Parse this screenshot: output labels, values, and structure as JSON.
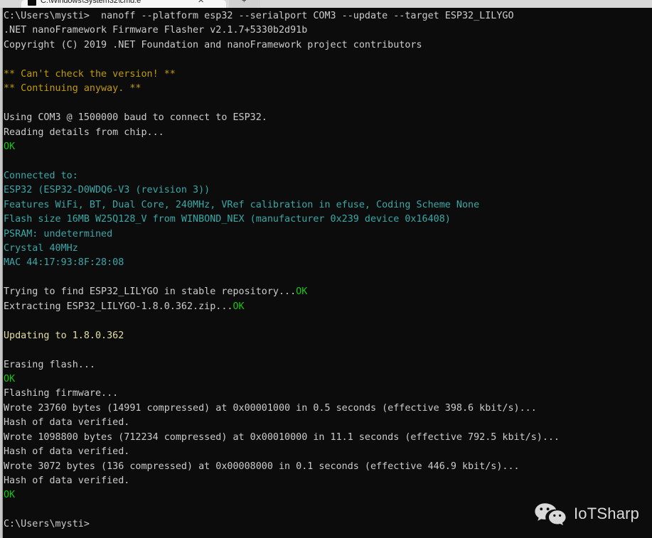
{
  "window": {
    "tab_title": "C:\\Windows\\System32\\cmd.e",
    "tab_close_label": "✕",
    "new_tab_label": "+"
  },
  "colors": {
    "background": "#0c0c0c",
    "foreground": "#cccccc",
    "gold": "#c19c00",
    "cyan": "#3aa8a8",
    "green": "#16c60c",
    "cream": "#e5dfa6",
    "tabstrip": "#d9d9d9"
  },
  "console": {
    "lines": [
      {
        "text": "C:\\Users\\mysti>  nanoff --platform esp32 --serialport COM3 --update --target ESP32_LILYGO",
        "color": "white"
      },
      {
        "text": ".NET nanoFramework Firmware Flasher v2.1.7+5330b2d91b",
        "color": "white"
      },
      {
        "text": "Copyright (C) 2019 .NET Foundation and nanoFramework project contributors",
        "color": "white"
      },
      {
        "text": "",
        "color": "white"
      },
      {
        "text": "** Can't check the version! **",
        "color": "gold"
      },
      {
        "text": "** Continuing anyway. **",
        "color": "gold"
      },
      {
        "text": "",
        "color": "white"
      },
      {
        "text": "Using COM3 @ 1500000 baud to connect to ESP32.",
        "color": "white"
      },
      {
        "text": "Reading details from chip...",
        "color": "white"
      },
      {
        "text": "OK",
        "color": "green"
      },
      {
        "text": "",
        "color": "white"
      },
      {
        "text": "Connected to:",
        "color": "cyan"
      },
      {
        "text": "ESP32 (ESP32-D0WDQ6-V3 (revision 3))",
        "color": "cyan"
      },
      {
        "text": "Features WiFi, BT, Dual Core, 240MHz, VRef calibration in efuse, Coding Scheme None",
        "color": "cyan"
      },
      {
        "text": "Flash size 16MB W25Q128_V from WINBOND_NEX (manufacturer 0x239 device 0x16408)",
        "color": "cyan"
      },
      {
        "text": "PSRAM: undetermined",
        "color": "cyan"
      },
      {
        "text": "Crystal 40MHz",
        "color": "cyan"
      },
      {
        "text": "MAC 44:17:93:8F:28:08",
        "color": "cyan"
      },
      {
        "text": "",
        "color": "white"
      },
      {
        "text": "Trying to find ESP32_LILYGO in stable repository...",
        "color": "white",
        "suffix": "OK",
        "suffix_color": "green"
      },
      {
        "text": "Extracting ESP32_LILYGO-1.8.0.362.zip...",
        "color": "white",
        "suffix": "OK",
        "suffix_color": "green"
      },
      {
        "text": "",
        "color": "white"
      },
      {
        "text": "Updating to 1.8.0.362",
        "color": "cream"
      },
      {
        "text": "",
        "color": "white"
      },
      {
        "text": "Erasing flash...",
        "color": "white"
      },
      {
        "text": "OK",
        "color": "green"
      },
      {
        "text": "Flashing firmware...",
        "color": "white"
      },
      {
        "text": "Wrote 23760 bytes (14991 compressed) at 0x00001000 in 0.5 seconds (effective 398.6 kbit/s)...",
        "color": "white"
      },
      {
        "text": "Hash of data verified.",
        "color": "white"
      },
      {
        "text": "Wrote 1098800 bytes (712234 compressed) at 0x00010000 in 11.1 seconds (effective 792.5 kbit/s)...",
        "color": "white"
      },
      {
        "text": "Hash of data verified.",
        "color": "white"
      },
      {
        "text": "Wrote 3072 bytes (136 compressed) at 0x00008000 in 0.1 seconds (effective 446.9 kbit/s)...",
        "color": "white"
      },
      {
        "text": "Hash of data verified.",
        "color": "white"
      },
      {
        "text": "OK",
        "color": "green"
      },
      {
        "text": "",
        "color": "white"
      },
      {
        "text": "C:\\Users\\mysti>",
        "color": "white"
      }
    ]
  },
  "watermark": {
    "label": "IoTSharp",
    "icon": "wechat-icon"
  }
}
